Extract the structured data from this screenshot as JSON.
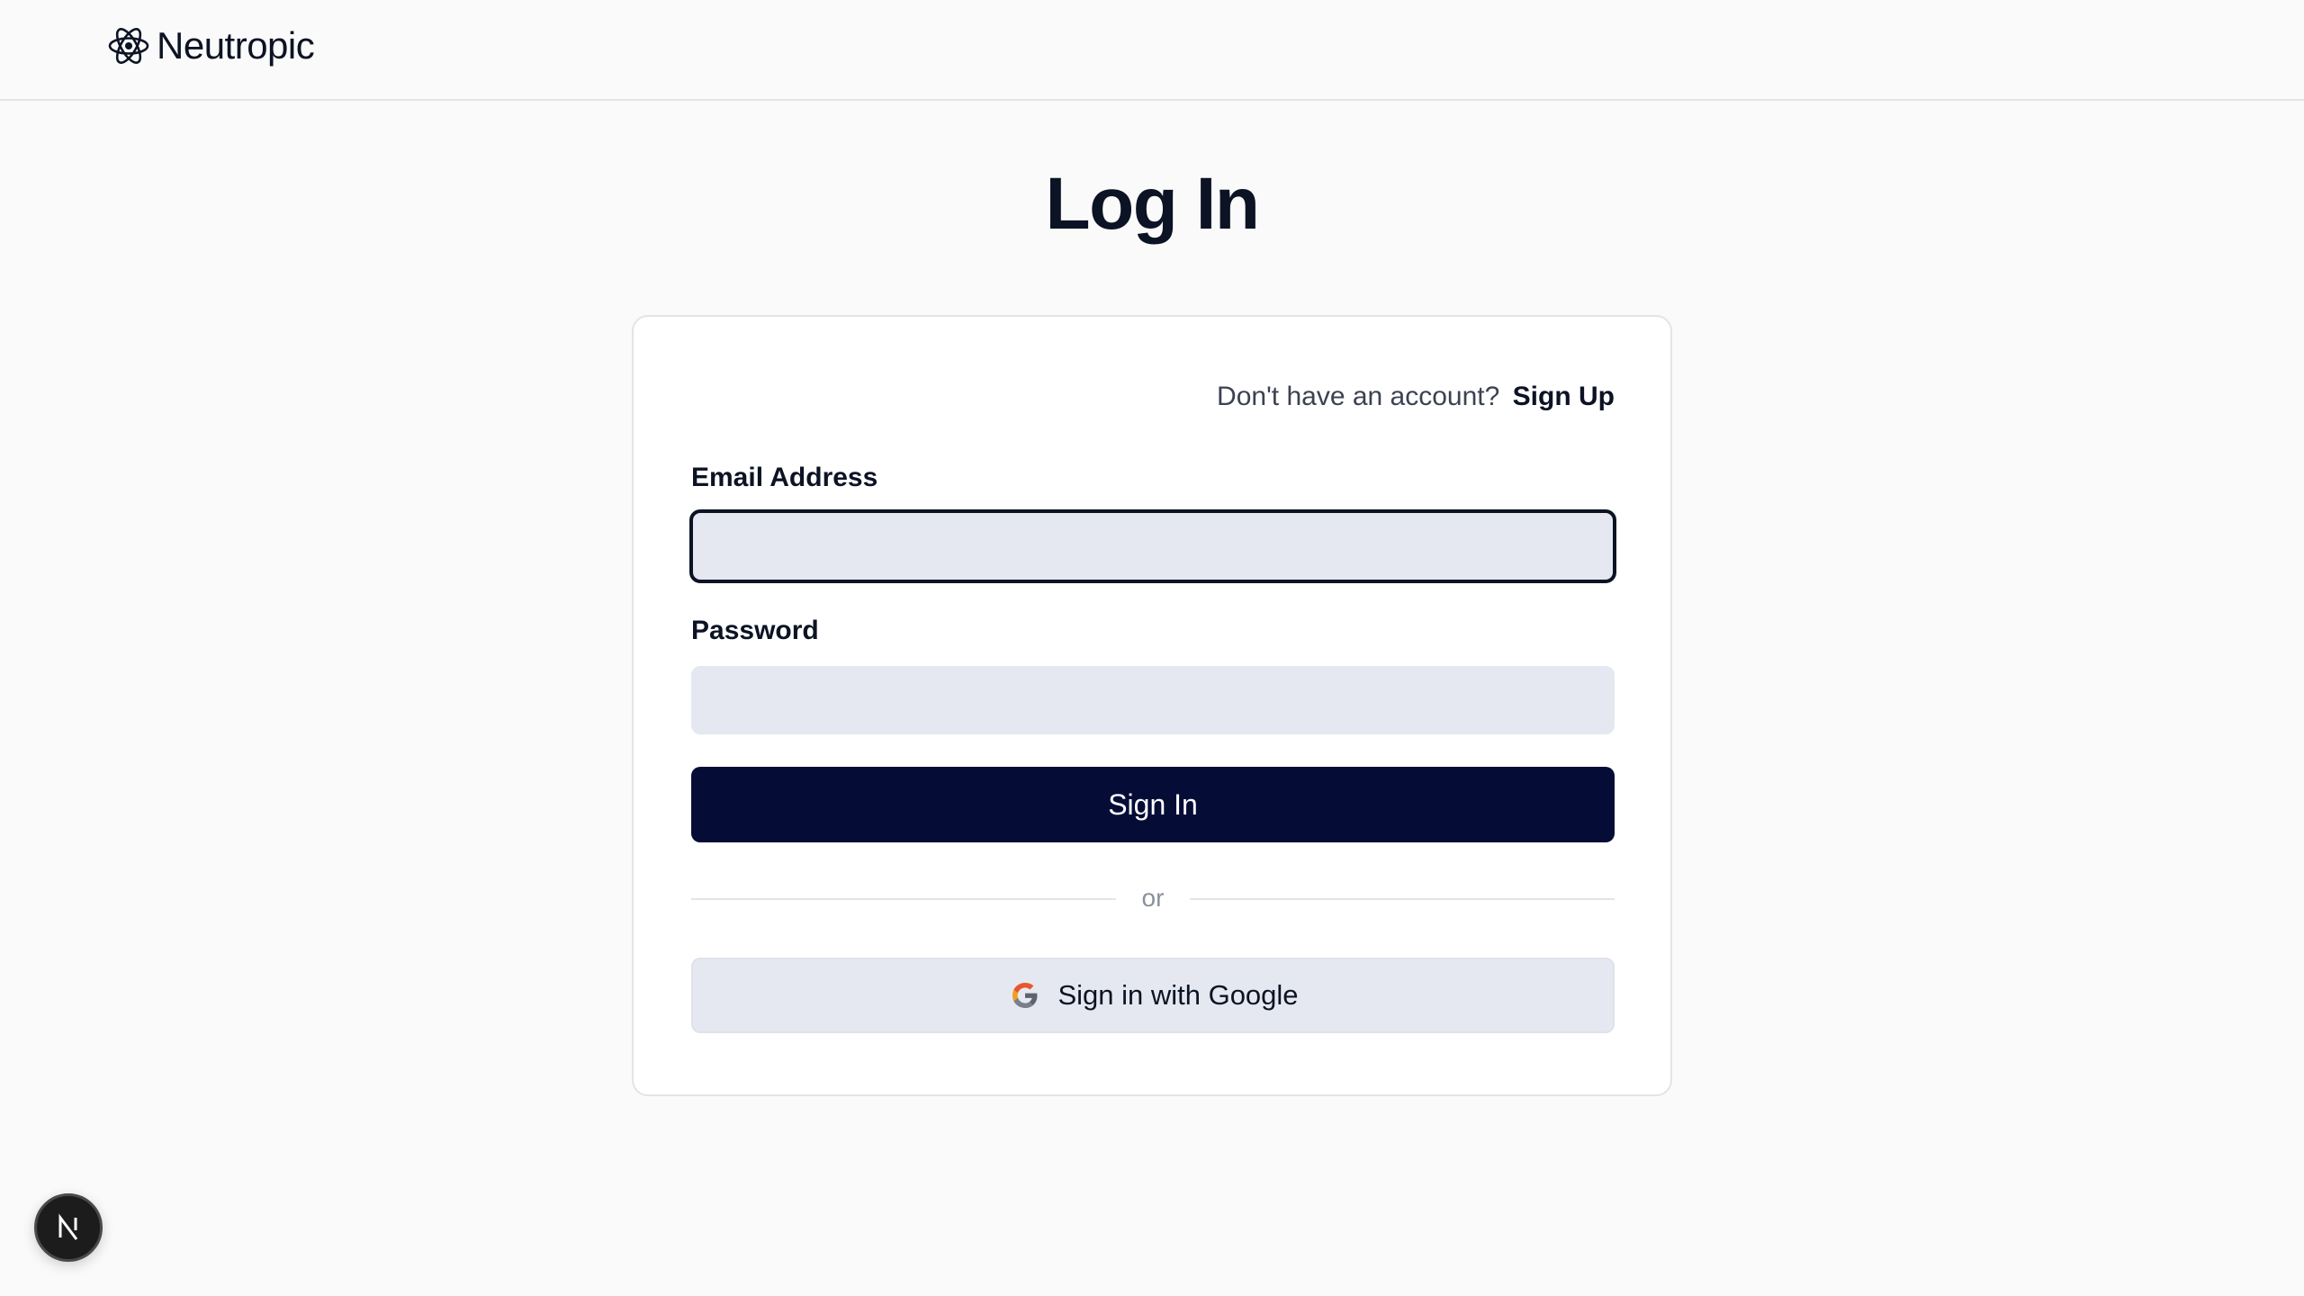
{
  "header": {
    "brand_name": "Neutropic",
    "brand_icon": "atom-icon"
  },
  "main": {
    "title": "Log In"
  },
  "login_form": {
    "signup_prompt": "Don't have an account?",
    "signup_link": "Sign Up",
    "email_label": "Email Address",
    "email_value": "",
    "email_placeholder": "",
    "password_label": "Password",
    "password_value": "",
    "password_placeholder": "",
    "submit_label": "Sign In",
    "divider_text": "or",
    "google_label": "Sign in with Google",
    "google_icon": "google-g-icon"
  },
  "dev_badge": {
    "letter": "N",
    "icon": "nextjs-icon"
  },
  "colors": {
    "background": "#fafafa",
    "primary_button": "#050d37",
    "input_background": "#e5e8f0",
    "text": "#0b1324"
  }
}
